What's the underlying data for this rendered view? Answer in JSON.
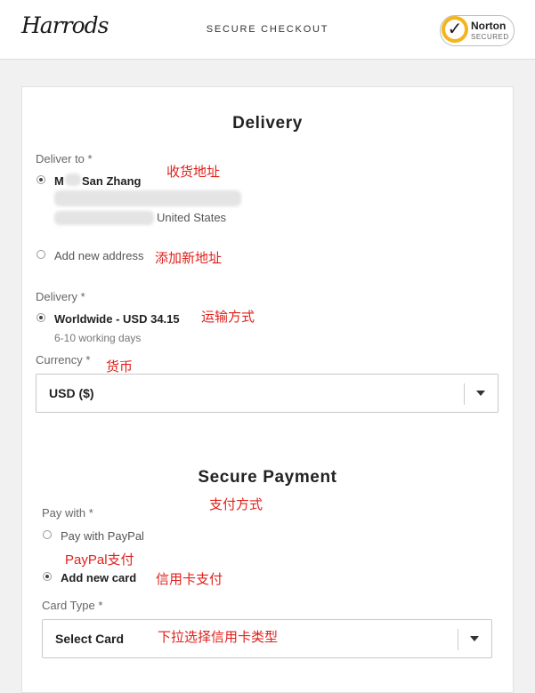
{
  "header": {
    "logo": "Harrods",
    "title": "SECURE CHECKOUT",
    "badge_name": "Norton",
    "badge_sub": "SECURED"
  },
  "delivery": {
    "title": "Delivery",
    "deliver_to_label": "Deliver to *",
    "name_prefix": "M",
    "name": "San Zhang",
    "country": "United States",
    "add_new_address": "Add new address",
    "delivery_label": "Delivery *",
    "shipping_option": "Worldwide - USD 34.15",
    "shipping_time": "6-10 working days",
    "currency_label": "Currency *",
    "currency_value": "USD ($)"
  },
  "payment": {
    "title": "Secure Payment",
    "pay_with_label": "Pay with *",
    "paypal": "Pay with PayPal",
    "new_card": "Add new card",
    "card_type_label": "Card Type *",
    "card_type_value": "Select Card"
  },
  "annotations": {
    "address": "收货地址",
    "add_address": "添加新地址",
    "shipping": "运输方式",
    "currency": "货币",
    "payment_method": "支付方式",
    "paypal": "PayPal支付",
    "credit_card": "信用卡支付",
    "card_select": "下拉选择信用卡类型"
  },
  "colors": {
    "annotation": "#e0201b",
    "norton_yellow": "#f4b41a"
  }
}
